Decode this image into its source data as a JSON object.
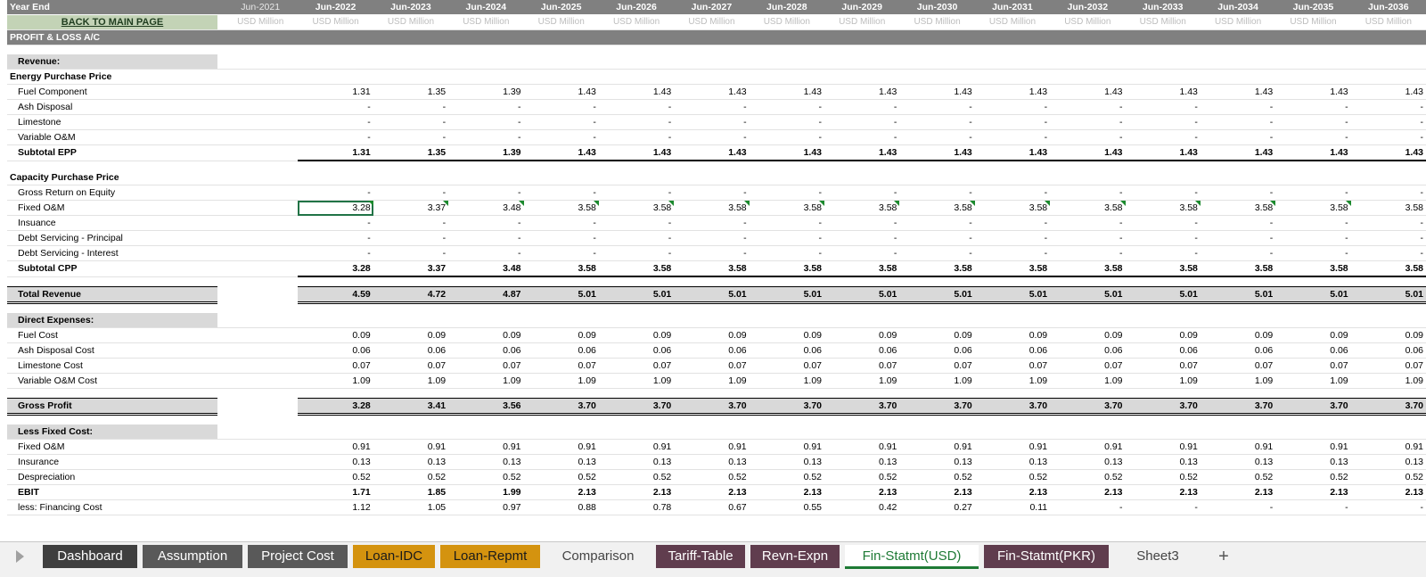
{
  "years": [
    "Jun-2021",
    "Jun-2022",
    "Jun-2023",
    "Jun-2024",
    "Jun-2025",
    "Jun-2026",
    "Jun-2027",
    "Jun-2028",
    "Jun-2029",
    "Jun-2030",
    "Jun-2031",
    "Jun-2032",
    "Jun-2033",
    "Jun-2034",
    "Jun-2035",
    "Jun-2036"
  ],
  "header": {
    "year_end_label": "Year End",
    "back_link": "BACK TO MAIN PAGE",
    "unit": "USD Million",
    "pl_title": "PROFIT & LOSS A/C"
  },
  "rows": [
    {
      "type": "blank"
    },
    {
      "type": "section",
      "label": "Revenue:"
    },
    {
      "type": "grouphead",
      "label": "Energy Purchase Price"
    },
    {
      "type": "item",
      "label": "Fuel Component",
      "values": [
        "",
        "1.31",
        "1.35",
        "1.39",
        "1.43",
        "1.43",
        "1.43",
        "1.43",
        "1.43",
        "1.43",
        "1.43",
        "1.43",
        "1.43",
        "1.43",
        "1.43",
        "1.43"
      ]
    },
    {
      "type": "item",
      "label": "Ash Disposal",
      "values": [
        "",
        "-",
        "-",
        "-",
        "-",
        "-",
        "-",
        "-",
        "-",
        "-",
        "-",
        "-",
        "-",
        "-",
        "-",
        "-"
      ]
    },
    {
      "type": "item",
      "label": "Limestone",
      "values": [
        "",
        "-",
        "-",
        "-",
        "-",
        "-",
        "-",
        "-",
        "-",
        "-",
        "-",
        "-",
        "-",
        "-",
        "-",
        "-"
      ]
    },
    {
      "type": "item",
      "label": "Variable O&M",
      "values": [
        "",
        "-",
        "-",
        "-",
        "-",
        "-",
        "-",
        "-",
        "-",
        "-",
        "-",
        "-",
        "-",
        "-",
        "-",
        "-"
      ]
    },
    {
      "type": "subtotal",
      "label": "Subtotal EPP",
      "values": [
        "",
        "1.31",
        "1.35",
        "1.39",
        "1.43",
        "1.43",
        "1.43",
        "1.43",
        "1.43",
        "1.43",
        "1.43",
        "1.43",
        "1.43",
        "1.43",
        "1.43",
        "1.43"
      ]
    },
    {
      "type": "blank"
    },
    {
      "type": "grouphead",
      "label": "Capacity Purchase Price"
    },
    {
      "type": "item",
      "label": "Gross Return on Equity",
      "values": [
        "",
        "-",
        "-",
        "-",
        "-",
        "-",
        "-",
        "-",
        "-",
        "-",
        "-",
        "-",
        "-",
        "-",
        "-",
        "-"
      ]
    },
    {
      "type": "item",
      "label": "Fixed O&M",
      "values": [
        "",
        "3.28",
        "3.37",
        "3.48",
        "3.58",
        "3.58",
        "3.58",
        "3.58",
        "3.58",
        "3.58",
        "3.58",
        "3.58",
        "3.58",
        "3.58",
        "3.58",
        "3.58"
      ],
      "selected": 1,
      "markers": true
    },
    {
      "type": "item",
      "label": "Insuance",
      "values": [
        "",
        "-",
        "-",
        "-",
        "-",
        "-",
        "-",
        "-",
        "-",
        "-",
        "-",
        "-",
        "-",
        "-",
        "-",
        "-"
      ]
    },
    {
      "type": "item",
      "label": "Debt Servicing - Principal",
      "values": [
        "",
        "-",
        "-",
        "-",
        "-",
        "-",
        "-",
        "-",
        "-",
        "-",
        "-",
        "-",
        "-",
        "-",
        "-",
        "-"
      ]
    },
    {
      "type": "item",
      "label": "Debt Servicing - Interest",
      "values": [
        "",
        "-",
        "-",
        "-",
        "-",
        "-",
        "-",
        "-",
        "-",
        "-",
        "-",
        "-",
        "-",
        "-",
        "-",
        "-"
      ]
    },
    {
      "type": "subtotal",
      "label": "Subtotal CPP",
      "values": [
        "",
        "3.28",
        "3.37",
        "3.48",
        "3.58",
        "3.58",
        "3.58",
        "3.58",
        "3.58",
        "3.58",
        "3.58",
        "3.58",
        "3.58",
        "3.58",
        "3.58",
        "3.58"
      ]
    },
    {
      "type": "blank"
    },
    {
      "type": "band",
      "label": "Total Revenue",
      "values": [
        "",
        "4.59",
        "4.72",
        "4.87",
        "5.01",
        "5.01",
        "5.01",
        "5.01",
        "5.01",
        "5.01",
        "5.01",
        "5.01",
        "5.01",
        "5.01",
        "5.01",
        "5.01"
      ]
    },
    {
      "type": "blank"
    },
    {
      "type": "section",
      "label": "Direct Expenses:"
    },
    {
      "type": "item",
      "label": "Fuel Cost",
      "values": [
        "",
        "0.09",
        "0.09",
        "0.09",
        "0.09",
        "0.09",
        "0.09",
        "0.09",
        "0.09",
        "0.09",
        "0.09",
        "0.09",
        "0.09",
        "0.09",
        "0.09",
        "0.09"
      ]
    },
    {
      "type": "item",
      "label": "Ash Disposal Cost",
      "values": [
        "",
        "0.06",
        "0.06",
        "0.06",
        "0.06",
        "0.06",
        "0.06",
        "0.06",
        "0.06",
        "0.06",
        "0.06",
        "0.06",
        "0.06",
        "0.06",
        "0.06",
        "0.06"
      ]
    },
    {
      "type": "item",
      "label": "Limestone Cost",
      "values": [
        "",
        "0.07",
        "0.07",
        "0.07",
        "0.07",
        "0.07",
        "0.07",
        "0.07",
        "0.07",
        "0.07",
        "0.07",
        "0.07",
        "0.07",
        "0.07",
        "0.07",
        "0.07"
      ]
    },
    {
      "type": "item",
      "label": "Variable O&M Cost",
      "values": [
        "",
        "1.09",
        "1.09",
        "1.09",
        "1.09",
        "1.09",
        "1.09",
        "1.09",
        "1.09",
        "1.09",
        "1.09",
        "1.09",
        "1.09",
        "1.09",
        "1.09",
        "1.09"
      ]
    },
    {
      "type": "blank"
    },
    {
      "type": "band",
      "label": "Gross Profit",
      "values": [
        "",
        "3.28",
        "3.41",
        "3.56",
        "3.70",
        "3.70",
        "3.70",
        "3.70",
        "3.70",
        "3.70",
        "3.70",
        "3.70",
        "3.70",
        "3.70",
        "3.70",
        "3.70"
      ]
    },
    {
      "type": "blank"
    },
    {
      "type": "section",
      "label": "Less Fixed Cost:"
    },
    {
      "type": "item",
      "label": "Fixed O&M",
      "values": [
        "",
        "0.91",
        "0.91",
        "0.91",
        "0.91",
        "0.91",
        "0.91",
        "0.91",
        "0.91",
        "0.91",
        "0.91",
        "0.91",
        "0.91",
        "0.91",
        "0.91",
        "0.91"
      ]
    },
    {
      "type": "item",
      "label": "Insurance",
      "values": [
        "",
        "0.13",
        "0.13",
        "0.13",
        "0.13",
        "0.13",
        "0.13",
        "0.13",
        "0.13",
        "0.13",
        "0.13",
        "0.13",
        "0.13",
        "0.13",
        "0.13",
        "0.13"
      ]
    },
    {
      "type": "item",
      "label": "Despreciation",
      "values": [
        "",
        "0.52",
        "0.52",
        "0.52",
        "0.52",
        "0.52",
        "0.52",
        "0.52",
        "0.52",
        "0.52",
        "0.52",
        "0.52",
        "0.52",
        "0.52",
        "0.52",
        "0.52"
      ]
    },
    {
      "type": "bold",
      "label": "EBIT",
      "values": [
        "",
        "1.71",
        "1.85",
        "1.99",
        "2.13",
        "2.13",
        "2.13",
        "2.13",
        "2.13",
        "2.13",
        "2.13",
        "2.13",
        "2.13",
        "2.13",
        "2.13",
        "2.13"
      ]
    },
    {
      "type": "item",
      "label": "less: Financing Cost",
      "values": [
        "",
        "1.12",
        "1.05",
        "0.97",
        "0.88",
        "0.78",
        "0.67",
        "0.55",
        "0.42",
        "0.27",
        "0.11",
        "-",
        "-",
        "-",
        "-",
        "-"
      ]
    }
  ],
  "sheet_tabs": [
    {
      "label": "Dashboard",
      "bg": "#3f3f3f",
      "fg": "#ffffff"
    },
    {
      "label": "Assumption",
      "bg": "#595959",
      "fg": "#ffffff"
    },
    {
      "label": "Project Cost",
      "bg": "#595959",
      "fg": "#ffffff"
    },
    {
      "label": "Loan-IDC",
      "bg": "#d4930f",
      "fg": "#1a1a1a"
    },
    {
      "label": "Loan-Repmt",
      "bg": "#d4930f",
      "fg": "#1a1a1a"
    },
    {
      "label": "Comparison",
      "bg": "#f1f1f1",
      "fg": "#444444"
    },
    {
      "label": "Tariff-Table",
      "bg": "#603d4e",
      "fg": "#ffffff"
    },
    {
      "label": "Revn-Expn",
      "bg": "#603d4e",
      "fg": "#ffffff"
    },
    {
      "label": "Fin-Statmt(USD)",
      "bg": "#ffffff",
      "fg": "#1e7a35",
      "active": true
    },
    {
      "label": "Fin-Statmt(PKR)",
      "bg": "#603d4e",
      "fg": "#ffffff"
    },
    {
      "label": "Sheet3",
      "bg": "#f1f1f1",
      "fg": "#444444"
    }
  ],
  "add_sheet_label": "+",
  "colors": {
    "header_gray": "#808080",
    "section_gray": "#d9d9d9",
    "back_green": "#c3d3b6",
    "selection": "#217346"
  }
}
